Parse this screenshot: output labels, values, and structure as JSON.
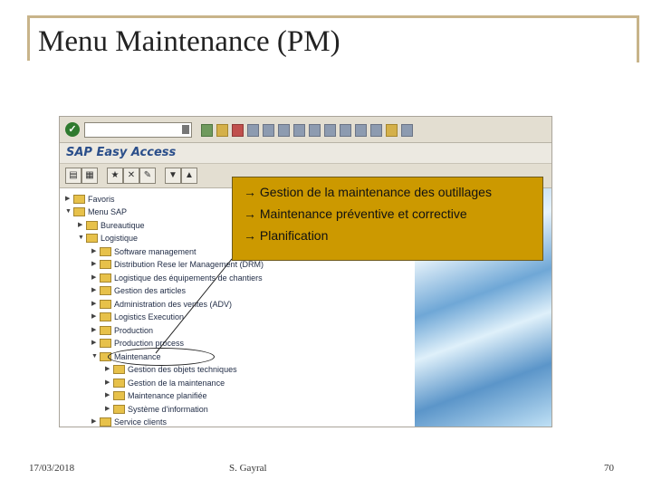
{
  "slide": {
    "title": "Menu Maintenance (PM)",
    "footer": {
      "date": "17/03/2018",
      "author": "S. Gayral",
      "page": "70"
    },
    "frame_color": "#c8b48a"
  },
  "sap": {
    "window_title": "SAP Easy Access",
    "tree": [
      {
        "label": "Favoris",
        "expanded": false
      },
      {
        "label": "Menu SAP",
        "expanded": true
      },
      {
        "label": "Bureautique",
        "expanded": false
      },
      {
        "label": "Logistique",
        "expanded": true
      },
      {
        "label": "Software management",
        "expanded": false
      },
      {
        "label": "Distribution Rese ler Management (DRM)",
        "expanded": false
      },
      {
        "label": "Logistique des équipements de chantiers",
        "expanded": false
      },
      {
        "label": "Gestion des articles",
        "expanded": false
      },
      {
        "label": "Administration des ventes (ADV)",
        "expanded": false
      },
      {
        "label": "Logistics Execution",
        "expanded": false
      },
      {
        "label": "Production",
        "expanded": false
      },
      {
        "label": "Production process",
        "expanded": false
      },
      {
        "label": "Maintenance",
        "expanded": true
      },
      {
        "label": "Gestion des objets techniques",
        "expanded": false
      },
      {
        "label": "Gestion de la maintenance",
        "expanded": false
      },
      {
        "label": "Maintenance planifiée",
        "expanded": false
      },
      {
        "label": "Système d'information",
        "expanded": false
      },
      {
        "label": "Service clients",
        "expanded": false
      }
    ],
    "callout": {
      "arrow": "→",
      "lines": [
        "Gestion de la maintenance des outillages",
        "Maintenance préventive et corrective",
        "Planification"
      ],
      "color": "#cc9900"
    },
    "highlighted_item": "Maintenance",
    "accent": "#2a4e8a"
  }
}
